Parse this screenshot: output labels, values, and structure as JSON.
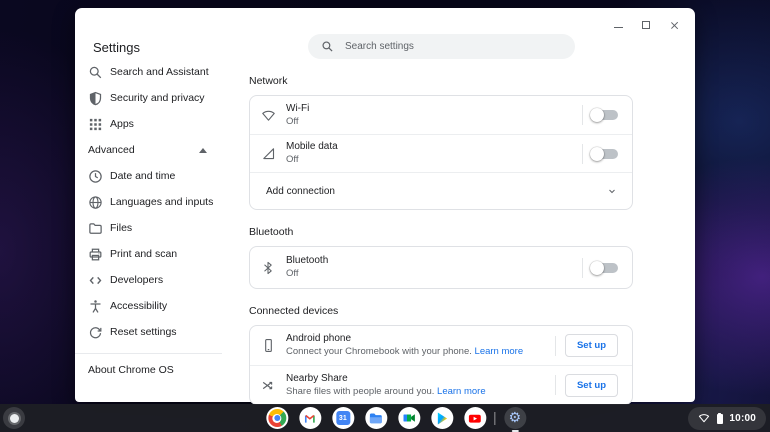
{
  "window": {
    "title": "Settings",
    "search": {
      "placeholder": "Search settings"
    },
    "sidebar": {
      "items": [
        {
          "label": "Search and Assistant",
          "icon": "search-icon"
        },
        {
          "label": "Security and privacy",
          "icon": "shield-icon"
        },
        {
          "label": "Apps",
          "icon": "apps-grid-icon"
        }
      ],
      "advanced_label": "Advanced",
      "advanced_items": [
        {
          "label": "Date and time",
          "icon": "clock-icon"
        },
        {
          "label": "Languages and inputs",
          "icon": "globe-icon"
        },
        {
          "label": "Files",
          "icon": "folder-icon"
        },
        {
          "label": "Print and scan",
          "icon": "printer-icon"
        },
        {
          "label": "Developers",
          "icon": "code-icon"
        },
        {
          "label": "Accessibility",
          "icon": "accessibility-icon"
        },
        {
          "label": "Reset settings",
          "icon": "reset-icon"
        }
      ],
      "about_label": "About Chrome OS"
    },
    "network": {
      "heading": "Network",
      "rows": [
        {
          "title": "Wi-Fi",
          "status": "Off",
          "enabled": false,
          "icon": "wifi-icon"
        },
        {
          "title": "Mobile data",
          "status": "Off",
          "enabled": false,
          "icon": "cellular-icon"
        }
      ],
      "add_connection_label": "Add connection"
    },
    "bluetooth": {
      "heading": "Bluetooth",
      "rows": [
        {
          "title": "Bluetooth",
          "status": "Off",
          "enabled": false,
          "icon": "bluetooth-icon"
        }
      ]
    },
    "connected_devices": {
      "heading": "Connected devices",
      "rows": [
        {
          "title": "Android phone",
          "description": "Connect your Chromebook with your phone.",
          "link_label": "Learn more",
          "button_label": "Set up",
          "icon": "smartphone-icon"
        },
        {
          "title": "Nearby Share",
          "description": "Share files with people around you.",
          "link_label": "Learn more",
          "button_label": "Set up",
          "icon": "nearby-share-icon"
        }
      ]
    }
  },
  "shelf": {
    "apps": [
      {
        "name": "Chrome"
      },
      {
        "name": "Gmail"
      },
      {
        "name": "Calendar",
        "day": "31"
      },
      {
        "name": "Files"
      },
      {
        "name": "Meet"
      },
      {
        "name": "Play Store"
      },
      {
        "name": "YouTube"
      },
      {
        "name": "Settings",
        "running": true
      }
    ],
    "icons": {
      "gear": "⚙"
    },
    "tray": {
      "time": "10:00"
    }
  },
  "colors": {
    "accent": "#1a73e8",
    "text_primary": "#202124",
    "text_secondary": "#5f6368",
    "toggle_off_track": "#bdc2c7",
    "shelf_bg": "#1d1e24"
  }
}
